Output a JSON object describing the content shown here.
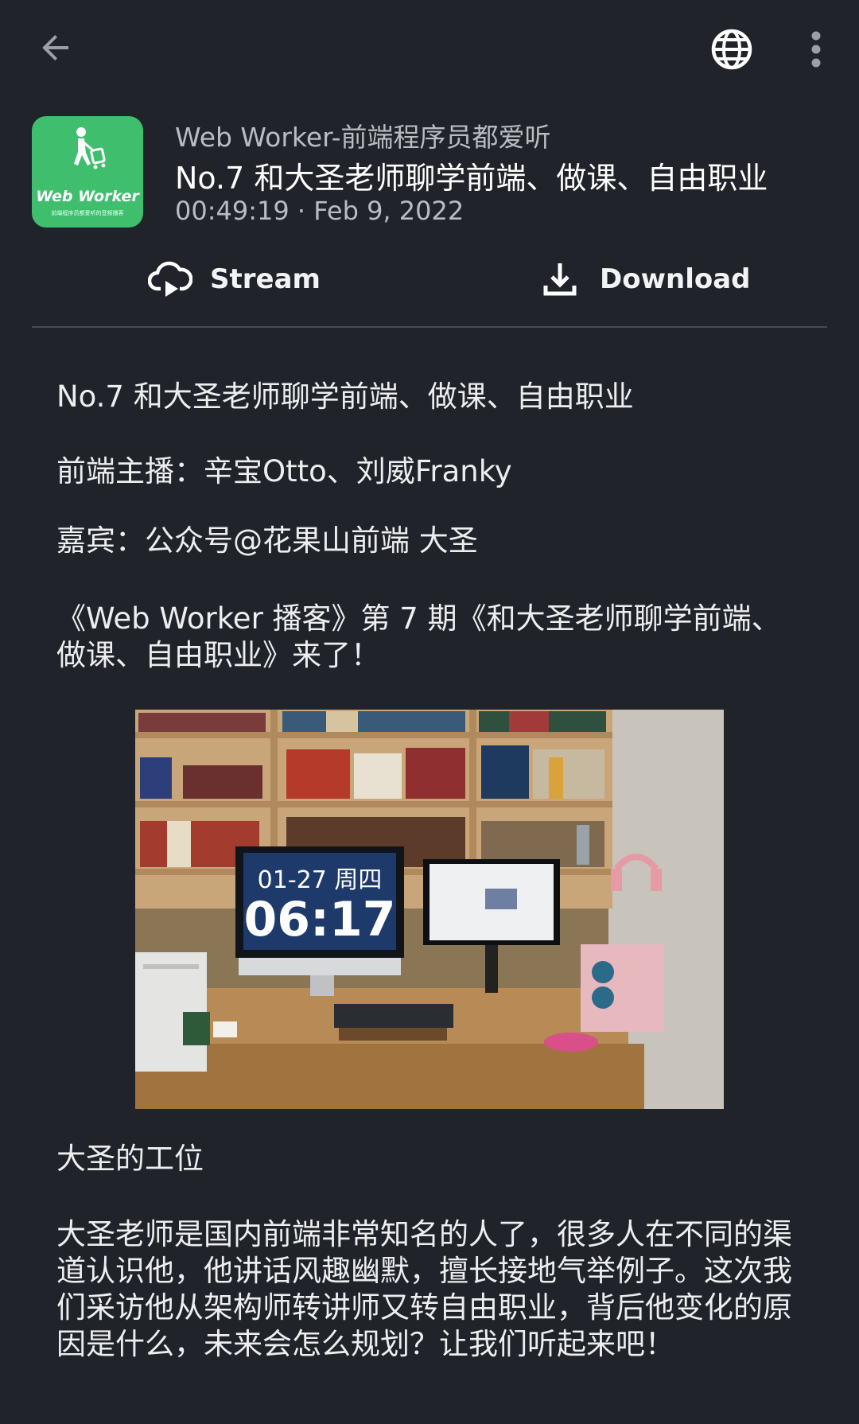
{
  "topbar": {
    "back_icon": "arrow-back-icon",
    "globe_icon": "globe-icon",
    "more_icon": "more-vert-icon"
  },
  "header": {
    "cover_title": "Web Worker",
    "cover_subtitle": "前端程序员都爱听的音频播客",
    "podcast_name": "Web Worker-前端程序员都爱听",
    "episode_title": "No.7 和大圣老师聊学前端、做课、自由职业",
    "meta": "00:49:19 · Feb 9, 2022"
  },
  "actions": {
    "stream_label": "Stream",
    "stream_icon": "cloud-play-icon",
    "download_label": "Download",
    "download_icon": "download-icon"
  },
  "description": {
    "heading": "No.7 和大圣老师聊学前端、做课、自由职业",
    "hosts": "前端主播：辛宝Otto、刘威Franky",
    "guest": "嘉宾：公众号@花果山前端 大圣",
    "intro": "《Web Worker 播客》第 7 期《和大圣老师聊学前端、做课、自由职业》来了！",
    "photo": {
      "clock_date": "01-27 周四",
      "clock_time": "06:17"
    },
    "photo_caption": "大圣的工位",
    "body": "大圣老师是国内前端非常知名的人了，很多人在不同的渠道认识他，他讲话风趣幽默，擅长接地气举例子。这次我们采访他从架构师转讲师又转自由职业，背后他变化的原因是什么，未来会怎么规划？让我们听起来吧！"
  },
  "colors": {
    "background": "#202329",
    "cover_green": "#3fbf6e",
    "text_primary": "#ffffff",
    "text_secondary": "#b9bcc1",
    "divider": "#474b52"
  }
}
